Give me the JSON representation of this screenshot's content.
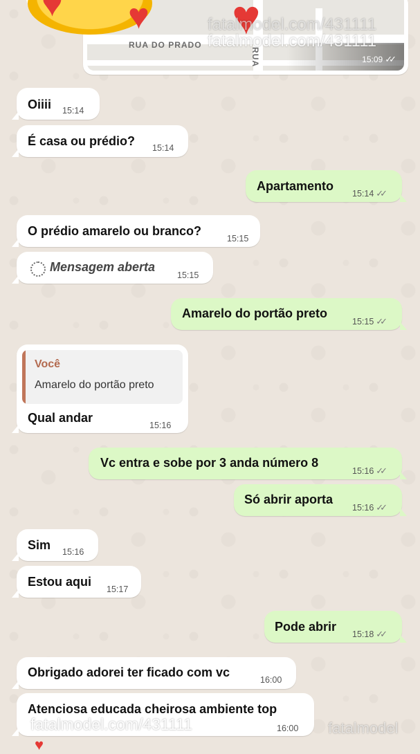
{
  "map": {
    "street_name": "RUA DO PRADO",
    "side_street": "RUA",
    "time": "15:09",
    "ticks": "✓✓"
  },
  "watermarks": {
    "top_faint": "fatalmodel.com/431111",
    "top": "fatalmodel.com/431111",
    "bottom": "fatalmodel.com/431111",
    "bottom_right": "fatalmodel"
  },
  "messages": [
    {
      "text": "Oiiii",
      "time": "15:14"
    },
    {
      "text": "É casa ou prédio?",
      "time": "15:14"
    },
    {
      "text": "Apartamento",
      "time": "15:14",
      "ticks": "✓✓"
    },
    {
      "text": "O prédio amarelo ou branco?",
      "time": "15:15"
    },
    {
      "text": "Mensagem aberta",
      "time": "15:15"
    },
    {
      "text": "Amarelo do portão preto",
      "time": "15:15",
      "ticks": "✓✓"
    },
    {
      "quote_author": "Você",
      "quote_text": "Amarelo do portão preto",
      "text": "Qual andar",
      "time": "15:16"
    },
    {
      "text": "Vc entra e sobe por 3 anda número 8",
      "time": "15:16",
      "ticks": "✓✓"
    },
    {
      "text": "Só abrir aporta",
      "time": "15:16",
      "ticks": "✓✓"
    },
    {
      "text": "Sim",
      "time": "15:16"
    },
    {
      "text": "Estou aqui",
      "time": "15:17"
    },
    {
      "text": "Pode abrir",
      "time": "15:18",
      "ticks": "✓✓"
    },
    {
      "text": "Obrigado adorei ter ficado com vc",
      "time": "16:00"
    },
    {
      "text": "Atenciosa educada cheirosa ambiente top",
      "time": "16:00"
    }
  ],
  "colors": {
    "wallpaper": "#ece5dd",
    "incoming": "#ffffff",
    "outgoing": "#dcf8c6",
    "quote_accent": "#c0765a"
  }
}
